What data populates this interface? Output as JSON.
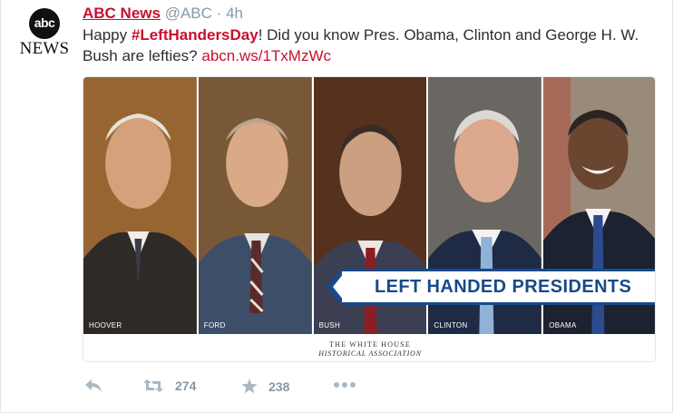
{
  "tweet": {
    "avatar": {
      "logo_text": "abc",
      "word": "NEWS"
    },
    "author_name": "ABC News",
    "handle": "@ABC",
    "separator": "·",
    "time": "4h",
    "text_before": "Happy ",
    "hashtag": "#LeftHandersDay",
    "text_after": "! Did you know Pres. Obama, Clinton and George H. W. Bush are lefties? ",
    "link": "abcn.ws/1TxMzWc"
  },
  "card": {
    "portraits": [
      {
        "label": "HOOVER",
        "bg": "#8a5a2b"
      },
      {
        "label": "FORD",
        "bg": "#6b4a30"
      },
      {
        "label": "BUSH",
        "bg": "#4a2a1a"
      },
      {
        "label": "CLINTON",
        "bg": "#5f5b57"
      },
      {
        "label": "OBAMA",
        "bg": "#9a8a7a"
      }
    ],
    "banner": "LEFT HANDED PRESIDENTS",
    "footer_line1": "THE WHITE HOUSE",
    "footer_line2": "HISTORICAL ASSOCIATION"
  },
  "actions": {
    "reply_icon": "reply-icon",
    "retweet_icon": "retweet-icon",
    "retweet_count": "274",
    "favorite_icon": "star-icon",
    "favorite_count": "238",
    "more_icon": "more-icon"
  },
  "colors": {
    "accent": "#c8102e",
    "banner_blue": "#174a8b",
    "muted": "#8899a6"
  }
}
